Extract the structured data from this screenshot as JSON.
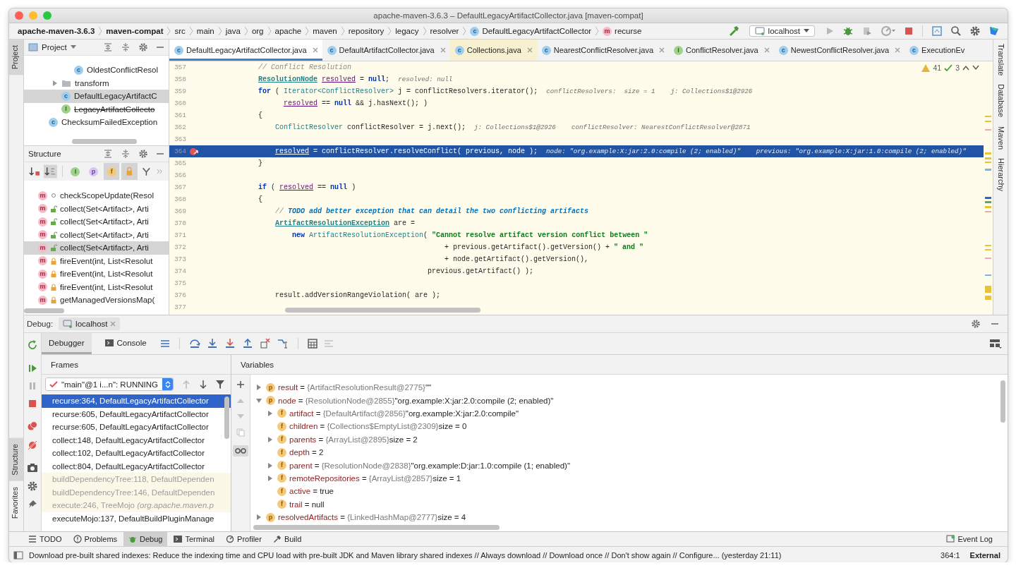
{
  "window": {
    "title": "apache-maven-3.6.3 – DefaultLegacyArtifactCollector.java [maven-compat]"
  },
  "breadcrumbs": [
    {
      "label": "apache-maven-3.6.3",
      "kind": "module"
    },
    {
      "label": "maven-compat",
      "kind": "module"
    },
    {
      "label": "src",
      "kind": "dir"
    },
    {
      "label": "main",
      "kind": "dir"
    },
    {
      "label": "java",
      "kind": "dir"
    },
    {
      "label": "org",
      "kind": "dir"
    },
    {
      "label": "apache",
      "kind": "dir"
    },
    {
      "label": "maven",
      "kind": "dir"
    },
    {
      "label": "repository",
      "kind": "dir"
    },
    {
      "label": "legacy",
      "kind": "dir"
    },
    {
      "label": "resolver",
      "kind": "dir"
    },
    {
      "label": "DefaultLegacyArtifactCollector",
      "kind": "class",
      "badge": "c"
    },
    {
      "label": "recurse",
      "kind": "method",
      "badge": "m"
    }
  ],
  "run_config": {
    "label": "localhost"
  },
  "left_strip": {
    "top": [
      {
        "label": "Project",
        "selected": true
      }
    ],
    "bottom": [
      {
        "label": "Structure",
        "selected": true
      },
      {
        "label": "Favorites",
        "selected": false
      }
    ]
  },
  "project": {
    "title": "Project",
    "tree": [
      {
        "children": [
          {
            "children": [
              {
                "label": "OldestConflictResol",
                "kind": "class",
                "badge": "c",
                "selected": false,
                "deprecated": false
              }
            ]
          },
          {
            "label": "transform",
            "kind": "folder",
            "expanded": false,
            "selected": false,
            "deprecated": false
          },
          {
            "label": "DefaultLegacyArtifactC",
            "kind": "class",
            "badge": "c",
            "selected": true,
            "deprecated": false
          },
          {
            "label": "LegacyArtifactCollecto",
            "kind": "interface",
            "badge": "I",
            "selected": false,
            "deprecated": true
          }
        ]
      },
      {
        "label": "ChecksumFailedException",
        "kind": "class",
        "badge": "c",
        "selected": false,
        "deprecated": false
      }
    ]
  },
  "structure": {
    "title": "Structure",
    "filters": [
      {
        "kind": "interface",
        "glyph": "I",
        "on": false
      },
      {
        "kind": "property",
        "glyph": "p",
        "on": false
      },
      {
        "kind": "field",
        "glyph": "f",
        "on": true
      },
      {
        "kind": "lock",
        "on": true
      }
    ],
    "items": [
      {
        "badge": "m",
        "label": "checkScopeUpdate(Resol",
        "kind": "package",
        "selected": false
      },
      {
        "badge": "m",
        "label": "collect(Set<Artifact>, Arti",
        "kind": "public",
        "selected": false
      },
      {
        "badge": "m",
        "label": "collect(Set<Artifact>, Arti",
        "kind": "public",
        "selected": false
      },
      {
        "badge": "m",
        "label": "collect(Set<Artifact>, Arti",
        "kind": "public",
        "selected": false
      },
      {
        "badge": "m",
        "label": "collect(Set<Artifact>, Arti",
        "kind": "public",
        "selected": true
      },
      {
        "badge": "m",
        "label": "fireEvent(int, List<Resolut",
        "kind": "private",
        "selected": false
      },
      {
        "badge": "m",
        "label": "fireEvent(int, List<Resolut",
        "kind": "private",
        "selected": false
      },
      {
        "badge": "m",
        "label": "fireEvent(int, List<Resolut",
        "kind": "private",
        "selected": false
      },
      {
        "badge": "m",
        "label": "getManagedVersionsMap(",
        "kind": "private",
        "selected": false
      }
    ]
  },
  "editor": {
    "tabs": [
      {
        "label": "DefaultLegacyArtifactCollector.java",
        "kind": "class",
        "badge": "c",
        "selected": true,
        "library": false
      },
      {
        "label": "DefaultArtifactCollector.java",
        "kind": "class",
        "badge": "c",
        "selected": false,
        "library": false
      },
      {
        "label": "Collections.java",
        "kind": "class",
        "badge": "c",
        "selected": false,
        "library": true
      },
      {
        "label": "NearestConflictResolver.java",
        "kind": "class",
        "badge": "c",
        "selected": false,
        "library": false
      },
      {
        "label": "ConflictResolver.java",
        "kind": "interface",
        "badge": "I",
        "selected": false,
        "library": false
      },
      {
        "label": "NewestConflictResolver.java",
        "kind": "class",
        "badge": "c",
        "selected": false,
        "library": false
      },
      {
        "label": "ExecutionEv",
        "kind": "class",
        "badge": "c",
        "selected": false,
        "library": false
      }
    ],
    "warnings": "41",
    "checks": "3",
    "lines": [
      {
        "num": "357",
        "current": false,
        "breakpoint": false,
        "segs": [
          {
            "t": "        // Conflict Resolution",
            "kind": "cmt"
          }
        ]
      },
      {
        "num": "358",
        "current": false,
        "breakpoint": false,
        "segs": [
          {
            "t": "        ResolutionNode",
            "kind": "link"
          },
          {
            "t": " resolved",
            "kind": "var"
          },
          {
            "t": " = "
          },
          {
            "t": "null",
            "kind": "kw"
          },
          {
            "t": ";"
          }
        ],
        "hints": [
          "resolved: null"
        ]
      },
      {
        "num": "359",
        "current": false,
        "breakpoint": false,
        "segs": [
          {
            "t": "        for",
            "kind": "kw"
          },
          {
            "t": " ( "
          },
          {
            "t": "Iterator<ConflictResolver>",
            "kind": "type"
          },
          {
            "t": " j = conflictResolvers.iterator();"
          }
        ],
        "hints": [
          "conflictResolvers:  size = 1",
          "j: Collections$1@2926"
        ]
      },
      {
        "num": "360",
        "current": false,
        "breakpoint": false,
        "segs": [
          {
            "t": "              resolved",
            "kind": "var"
          },
          {
            "t": " == "
          },
          {
            "t": "null",
            "kind": "kw"
          },
          {
            "t": " && j.hasNext(); )"
          }
        ]
      },
      {
        "num": "361",
        "current": false,
        "breakpoint": false,
        "segs": [
          {
            "t": "        {"
          }
        ]
      },
      {
        "num": "362",
        "current": false,
        "breakpoint": false,
        "segs": [
          {
            "t": "            ConflictResolver",
            "kind": "type"
          },
          {
            "t": " conflictResolver = j.next();"
          }
        ],
        "hints": [
          "j: Collections$1@2926",
          "conflictResolver: NearestConflictResolver@2871"
        ]
      },
      {
        "num": "363",
        "current": false,
        "breakpoint": false
      },
      {
        "num": "364",
        "current": true,
        "breakpoint": true,
        "segs": [
          {
            "t": "            resolved",
            "kind": "var"
          },
          {
            "t": " = conflictResolver.resolveConflict( previous, node );"
          }
        ],
        "hints": [
          "node: \"org.example:X:jar:2.0:compile (2; enabled)\"",
          "previous: \"org.example:X:jar:1.0:compile (2; enabled)\""
        ]
      },
      {
        "num": "365",
        "current": false,
        "breakpoint": false,
        "segs": [
          {
            "t": "        }"
          }
        ]
      },
      {
        "num": "366",
        "current": false,
        "breakpoint": false
      },
      {
        "num": "367",
        "current": false,
        "breakpoint": false,
        "segs": [
          {
            "t": "        if",
            "kind": "kw"
          },
          {
            "t": " ( "
          },
          {
            "t": "resolved",
            "kind": "var"
          },
          {
            "t": " == "
          },
          {
            "t": "null",
            "kind": "kw"
          },
          {
            "t": " )"
          }
        ]
      },
      {
        "num": "368",
        "current": false,
        "breakpoint": false,
        "segs": [
          {
            "t": "        {"
          }
        ]
      },
      {
        "num": "369",
        "current": false,
        "breakpoint": false,
        "segs": [
          {
            "t": "            // ",
            "kind": "cmt"
          },
          {
            "t": "TODO add better exception that can detail the two conflicting artifacts",
            "kind": "todo"
          }
        ]
      },
      {
        "num": "370",
        "current": false,
        "breakpoint": false,
        "segs": [
          {
            "t": "            ArtifactResolutionException",
            "kind": "link"
          },
          {
            "t": " are ="
          }
        ]
      },
      {
        "num": "371",
        "current": false,
        "breakpoint": false,
        "segs": [
          {
            "t": "                new",
            "kind": "kw"
          },
          {
            "t": " ArtifactResolutionException",
            "kind": "type"
          },
          {
            "t": "( "
          },
          {
            "t": "\"Cannot resolve artifact version conflict between \"",
            "kind": "str"
          }
        ]
      },
      {
        "num": "372",
        "current": false,
        "breakpoint": false,
        "segs": [
          {
            "t": "                                                    + previous.getArtifact().getVersion() + "
          },
          {
            "t": "\" and \"",
            "kind": "str"
          }
        ]
      },
      {
        "num": "373",
        "current": false,
        "breakpoint": false,
        "segs": [
          {
            "t": "                                                    + node.getArtifact().getVersion(),"
          }
        ]
      },
      {
        "num": "374",
        "current": false,
        "breakpoint": false,
        "segs": [
          {
            "t": "                                                previous.getArtifact() );"
          }
        ]
      },
      {
        "num": "375",
        "current": false,
        "breakpoint": false
      },
      {
        "num": "376",
        "current": false,
        "breakpoint": false,
        "segs": [
          {
            "t": "            result.addVersionRangeViolation( are );"
          }
        ]
      },
      {
        "num": "377",
        "current": false,
        "breakpoint": false
      }
    ]
  },
  "right_strip": [
    {
      "label": "Translate"
    },
    {
      "label": "Database"
    },
    {
      "label": "Maven"
    },
    {
      "label": "Hierarchy"
    }
  ],
  "debug": {
    "title": "Debug:",
    "session": "localhost",
    "tabs": [
      {
        "label": "Debugger",
        "selected": true
      },
      {
        "label": "Console",
        "selected": false
      }
    ],
    "frames": {
      "title": "Frames",
      "thread": "\"main\"@1 i...n\": RUNNING",
      "items": [
        {
          "label": "recurse:364, DefaultLegacyArtifactCollector",
          "selected": true,
          "library": false
        },
        {
          "label": "recurse:605, DefaultLegacyArtifactCollector",
          "selected": false,
          "library": false
        },
        {
          "label": "recurse:605, DefaultLegacyArtifactCollector",
          "selected": false,
          "library": false
        },
        {
          "label": "collect:148, DefaultLegacyArtifactCollector",
          "selected": false,
          "library": false
        },
        {
          "label": "collect:102, DefaultLegacyArtifactCollector",
          "selected": false,
          "library": false
        },
        {
          "label": "collect:804, DefaultLegacyArtifactCollector",
          "selected": false,
          "library": false
        },
        {
          "label": "buildDependencyTree:118, DefaultDependen",
          "selected": false,
          "library": true
        },
        {
          "label": "buildDependencyTree:146, DefaultDependen",
          "selected": false,
          "library": true
        },
        {
          "label": "execute:246, TreeMojo *(org.apache.maven.p*",
          "selected": false,
          "library": true
        },
        {
          "label": "executeMojo:137, DefaultBuildPluginManage",
          "selected": false,
          "library": false
        }
      ]
    },
    "variables": {
      "title": "Variables",
      "items": [
        {
          "kind": "param",
          "badge": "p",
          "name": "result",
          "op": "=",
          "type": "{ArtifactResolutionResult@2775}",
          "value": "\"\"",
          "expanded": false
        },
        {
          "kind": "param",
          "badge": "p",
          "name": "node",
          "op": "=",
          "type": "{ResolutionNode@2855}",
          "value": "\"org.example:X:jar:2.0:compile (2; enabled)\"",
          "expanded": true,
          "children": [
            {
              "kind": "field",
              "badge": "f",
              "name": "artifact",
              "op": "=",
              "type": "{DefaultArtifact@2856}",
              "value": "\"org.example:X:jar:2.0:compile\"",
              "expanded": false
            },
            {
              "kind": "field",
              "badge": "f",
              "name": "children",
              "op": "=",
              "type": "{Collections$EmptyList@2309}",
              "value": "size = 0"
            },
            {
              "kind": "field",
              "badge": "f",
              "name": "parents",
              "op": "=",
              "type": "{ArrayList@2895}",
              "value": "size = 2",
              "expanded": false
            },
            {
              "kind": "field",
              "badge": "f",
              "name": "depth",
              "op": "=",
              "value": "2"
            },
            {
              "kind": "field",
              "badge": "f",
              "name": "parent",
              "op": "=",
              "type": "{ResolutionNode@2838}",
              "value": "\"org.example:D:jar:1.0:compile (1; enabled)\"",
              "expanded": false
            },
            {
              "kind": "field",
              "badge": "f",
              "name": "remoteRepositories",
              "op": "=",
              "type": "{ArrayList@2857}",
              "value": "size = 1",
              "expanded": false
            },
            {
              "kind": "field",
              "badge": "f",
              "name": "active",
              "op": "=",
              "value": "true"
            },
            {
              "kind": "field",
              "badge": "f",
              "name": "trail",
              "op": "=",
              "value": "null"
            }
          ]
        },
        {
          "kind": "param",
          "badge": "p",
          "name": "resolvedArtifacts",
          "op": "=",
          "type": "{LinkedHashMap@2777}",
          "value": "size = 4",
          "expanded": false
        }
      ]
    }
  },
  "tool_tabs": [
    {
      "label": "TODO",
      "kind": "list",
      "selected": false
    },
    {
      "label": "Problems",
      "kind": "problems",
      "selected": false
    },
    {
      "label": "Debug",
      "kind": "bug",
      "selected": true
    },
    {
      "label": "Terminal",
      "kind": "terminal",
      "selected": false
    },
    {
      "label": "Profiler",
      "kind": "profiler",
      "selected": false
    },
    {
      "label": "Build",
      "kind": "hammer",
      "selected": false
    }
  ],
  "event_log": "Event Log",
  "status_bar": {
    "message": "Download pre-built shared indexes: Reduce the indexing time and CPU load with pre-built JDK and Maven library shared indexes // Always download // Download once // Don't show again // Configure... (yesterday 21:11)",
    "position": "364:1",
    "vcs": "External"
  }
}
